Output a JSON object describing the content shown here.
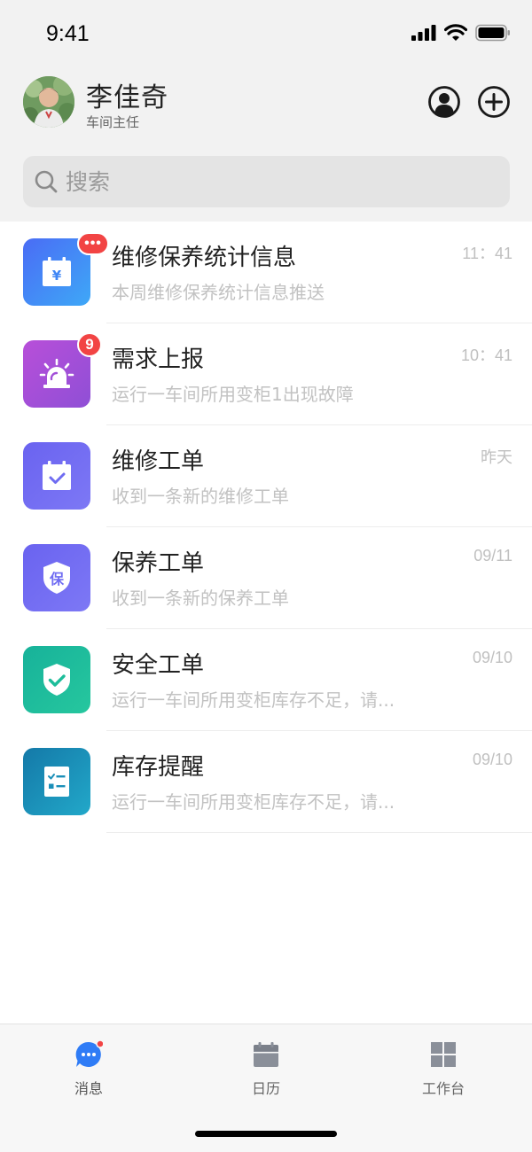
{
  "status_bar": {
    "time": "9:41"
  },
  "header": {
    "user_name": "李佳奇",
    "user_role": "车间主任"
  },
  "search": {
    "placeholder": "搜索"
  },
  "messages": [
    {
      "title": "维修保养统计信息",
      "preview": "本周维修保养统计信息推送",
      "time": "11：41",
      "badge": "•••",
      "icon": "calendar-yen-icon",
      "color": "#3f86f5"
    },
    {
      "title": "需求上报",
      "preview": "运行一车间所用变柜1出现故障",
      "time": "10：41",
      "badge": "9",
      "icon": "alarm-light-icon",
      "color": "#a24fd8"
    },
    {
      "title": "维修工单",
      "preview": "收到一条新的维修工单",
      "time": "昨天",
      "badge": "",
      "icon": "calendar-check-icon",
      "color": "#6f6cf2"
    },
    {
      "title": "保养工单",
      "preview": "收到一条新的保养工单",
      "time": "09/11",
      "badge": "",
      "icon": "shield-bao-icon",
      "color": "#6f6cf2"
    },
    {
      "title": "安全工单",
      "preview": "运行一车间所用变柜库存不足，请...",
      "time": "09/10",
      "badge": "",
      "icon": "shield-check-icon",
      "color": "#1dbd9a"
    },
    {
      "title": "库存提醒",
      "preview": "运行一车间所用变柜库存不足，请...",
      "time": "09/10",
      "badge": "",
      "icon": "checklist-icon",
      "color": "#1b8fb8"
    }
  ],
  "tab_bar": {
    "items": [
      {
        "label": "消息",
        "icon": "chat-bubble-icon",
        "active": true
      },
      {
        "label": "日历",
        "icon": "calendar-icon",
        "active": false
      },
      {
        "label": "工作台",
        "icon": "grid-icon",
        "active": false
      }
    ]
  },
  "colors": {
    "accent": "#2f7cf6",
    "badge": "#f24444"
  }
}
